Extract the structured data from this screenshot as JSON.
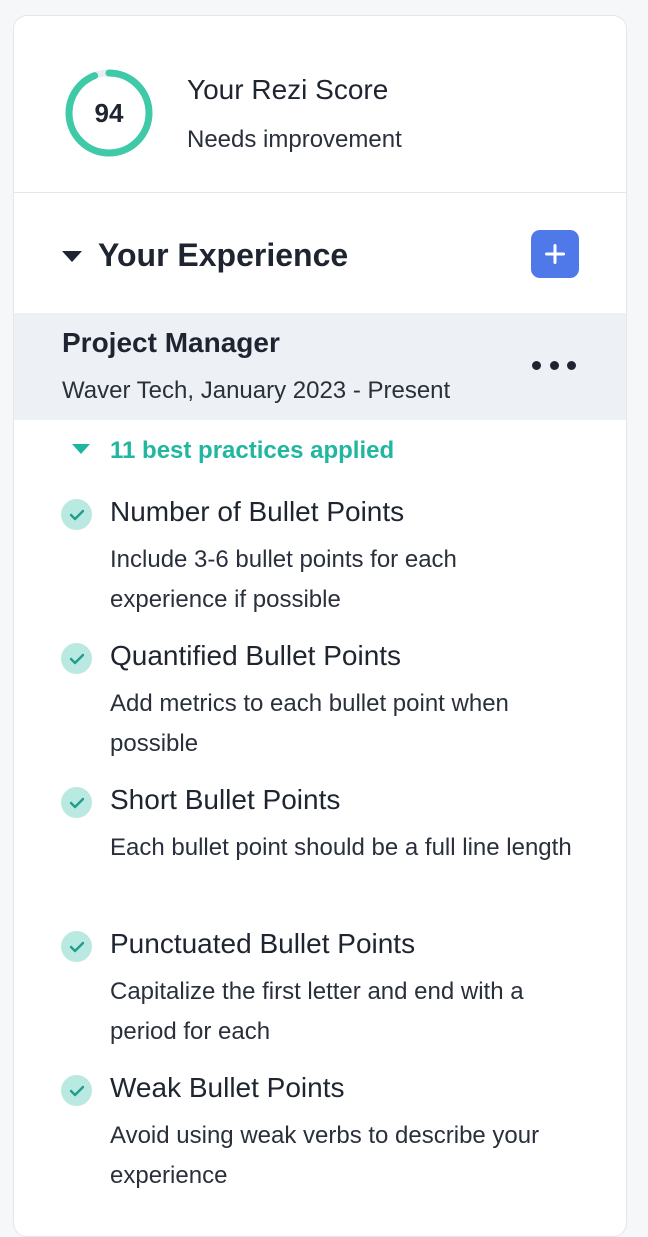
{
  "score": {
    "value": "94",
    "fraction": 0.94,
    "title": "Your Rezi Score",
    "status": "Needs improvement",
    "ring_color": "#3ec9a7",
    "track_color": "#e7eef2"
  },
  "experience": {
    "title": "Your Experience",
    "add_icon": "plus-icon",
    "accent": "#4f78e8"
  },
  "job": {
    "title": "Project Manager",
    "meta": "Waver Tech, January 2023 - Present",
    "menu_icon": "more-icon"
  },
  "best_practices": {
    "label": "11 best practices applied",
    "color": "#20b6a0",
    "items": [
      {
        "title": "Number of Bullet Points",
        "desc": "Include 3-6 bullet points for each experience if possible"
      },
      {
        "title": "Quantified Bullet Points",
        "desc": "Add metrics to each bullet point when possible"
      },
      {
        "title": "Short Bullet Points",
        "desc": "Each bullet point should be a full line length"
      },
      {
        "title": "Punctuated Bullet Points",
        "desc": "Capitalize the first letter and end with a period for each"
      },
      {
        "title": "Weak Bullet Points",
        "desc": "Avoid using weak verbs to describe your experience"
      }
    ]
  }
}
